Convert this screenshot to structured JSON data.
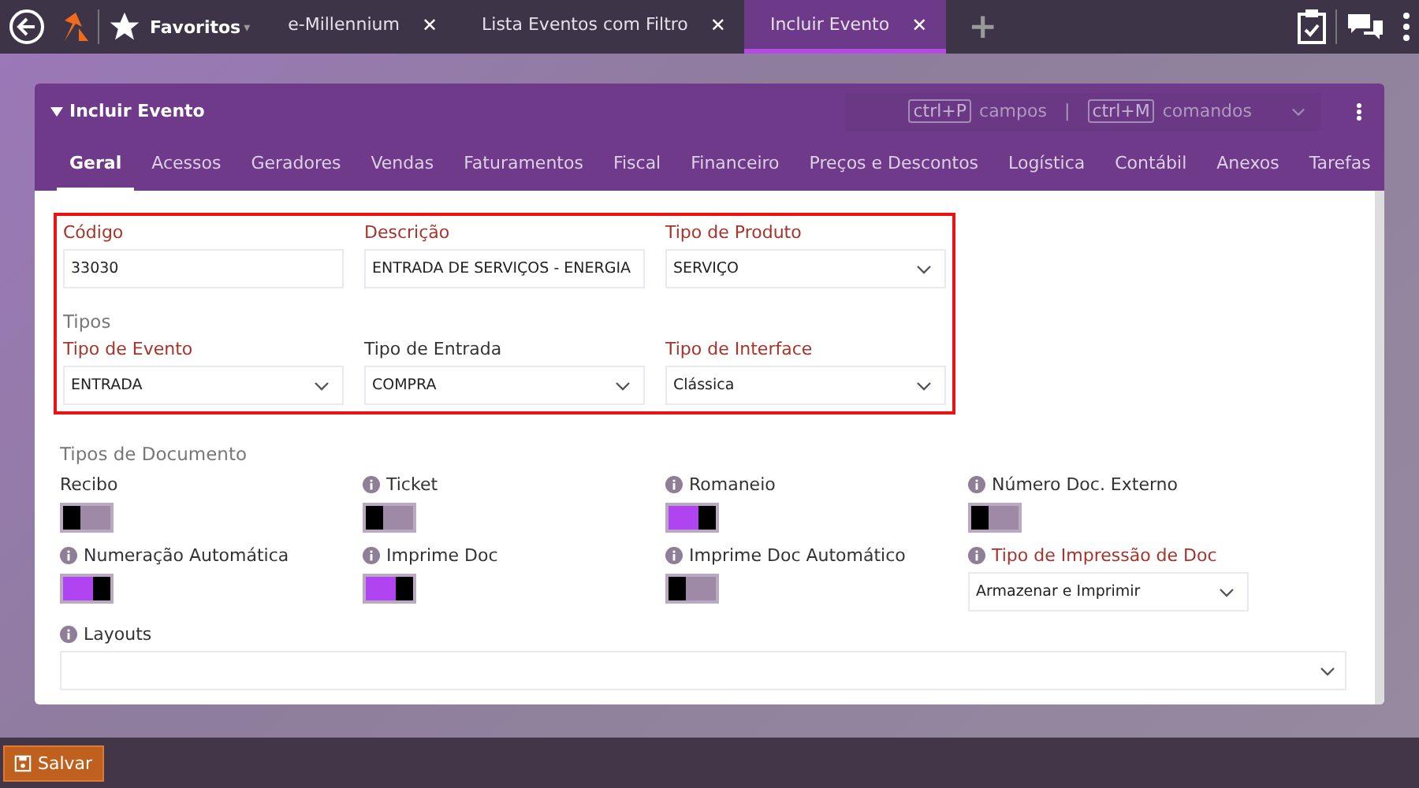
{
  "topbar": {
    "favorites": "Favoritos",
    "favorites_caret": "▾",
    "tabs": [
      {
        "label": "e-Millennium",
        "selected": false
      },
      {
        "label": "Lista Eventos com Filtro",
        "selected": false
      },
      {
        "label": "Incluir Evento",
        "selected": true
      }
    ],
    "close": "✕",
    "add": "+"
  },
  "panel": {
    "title": "Incluir Evento",
    "shortcuts": [
      {
        "key": "ctrl+P",
        "label": "campos"
      },
      {
        "key": "ctrl+M",
        "label": "comandos"
      }
    ],
    "separator": "|"
  },
  "tabs": [
    {
      "label": "Geral",
      "selected": true
    },
    {
      "label": "Acessos",
      "selected": false
    },
    {
      "label": "Geradores",
      "selected": false
    },
    {
      "label": "Vendas",
      "selected": false
    },
    {
      "label": "Faturamentos",
      "selected": false
    },
    {
      "label": "Fiscal",
      "selected": false
    },
    {
      "label": "Financeiro",
      "selected": false
    },
    {
      "label": "Preços e Descontos",
      "selected": false
    },
    {
      "label": "Logística",
      "selected": false
    },
    {
      "label": "Contábil",
      "selected": false
    },
    {
      "label": "Anexos",
      "selected": false
    },
    {
      "label": "Tarefas",
      "selected": false
    }
  ],
  "main_fields": {
    "highlighted": true,
    "rows": [
      [
        {
          "label": "Código",
          "value": "33030",
          "kind": "text",
          "required": true
        },
        {
          "label": "Descrição",
          "value": "ENTRADA DE SERVIÇOS - ENERGIA",
          "kind": "text",
          "required": true
        },
        {
          "label": "Tipo de Produto",
          "value": "SERVIÇO",
          "kind": "select",
          "required": true
        }
      ],
      [
        {
          "label": "Tipo de Evento",
          "value": "ENTRADA",
          "kind": "select",
          "required": true
        },
        {
          "label": "Tipo de Entrada",
          "value": "COMPRA",
          "kind": "select",
          "required": false
        },
        {
          "label": "Tipo de Interface",
          "value": "Clássica",
          "kind": "select",
          "required": true
        }
      ]
    ],
    "subtitle": "Tipos"
  },
  "documents": {
    "title": "Tipos de Documento",
    "items": [
      {
        "kind": "toggle",
        "label": "Recibo",
        "info": false,
        "on": false
      },
      {
        "kind": "toggle",
        "label": "Ticket",
        "info": true,
        "on": false
      },
      {
        "kind": "toggle",
        "label": "Romaneio",
        "info": true,
        "on": true
      },
      {
        "kind": "toggle",
        "label": "Número Doc. Externo",
        "info": true,
        "on": false
      },
      {
        "kind": "toggle",
        "label": "Numeração Automática",
        "info": true,
        "on": true
      },
      {
        "kind": "toggle",
        "label": "Imprime Doc",
        "info": true,
        "on": true
      },
      {
        "kind": "toggle",
        "label": "Imprime Doc Automático",
        "info": true,
        "on": false
      },
      {
        "kind": "select",
        "label": "Tipo de Impressão de Doc",
        "info": true,
        "required": true,
        "value": "Armazenar e Imprimir"
      },
      {
        "kind": "wide_select",
        "label": "Layouts",
        "info": true,
        "required": false
      }
    ]
  },
  "save_button": "Salvar"
}
